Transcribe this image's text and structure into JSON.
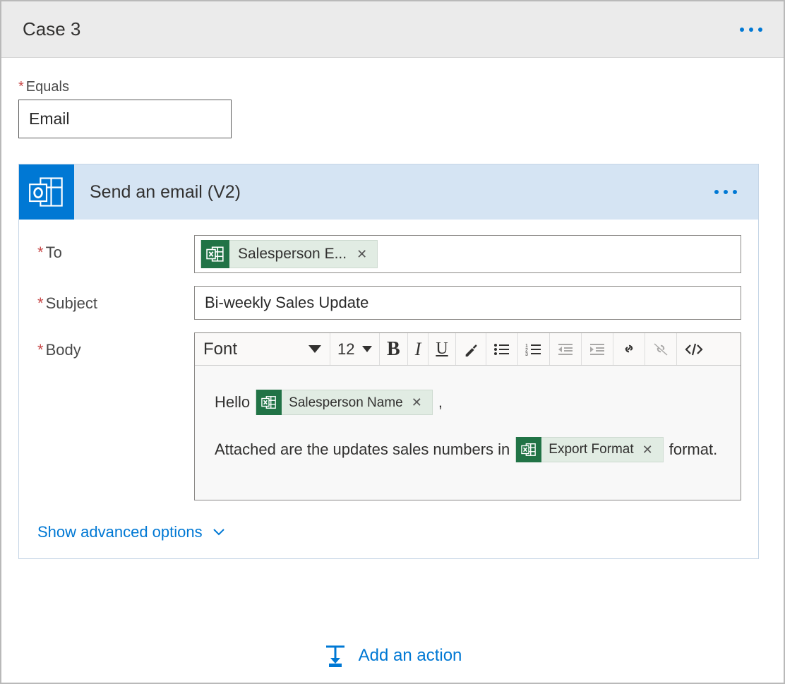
{
  "header": {
    "title": "Case 3"
  },
  "equals": {
    "label": "Equals",
    "value": "Email"
  },
  "action": {
    "title": "Send an email (V2)",
    "fields": {
      "to_label": "To",
      "subject_label": "Subject",
      "body_label": "Body",
      "subject_value": "Bi-weekly Sales Update"
    },
    "tokens": {
      "to_token": "Salesperson E...",
      "body_name_token": "Salesperson Name",
      "body_format_token": "Export Format"
    },
    "body_text": {
      "hello": "Hello",
      "comma": ",",
      "line2_pre": "Attached are the updates sales numbers in",
      "line2_post": "format."
    },
    "toolbar": {
      "font_label": "Font",
      "size_label": "12"
    },
    "advanced_link": "Show advanced options"
  },
  "add_action": {
    "label": "Add an action"
  }
}
